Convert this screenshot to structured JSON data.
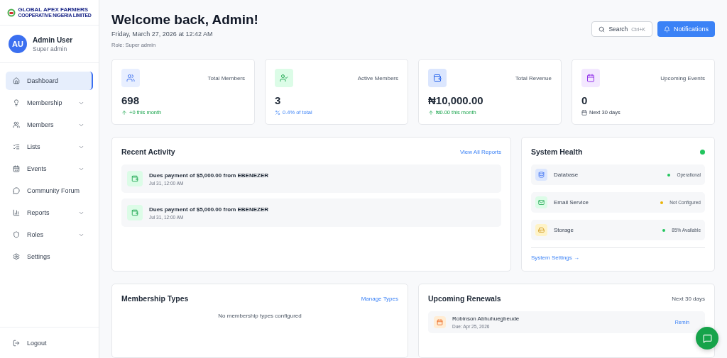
{
  "sidebar": {
    "logo": {
      "line_1": "GLOBAL APEX FARMERS",
      "line_2": "COOPERATIVE NIGERIA LIMITED"
    },
    "user": {
      "initials": "AU",
      "name": "Admin User",
      "role": "Super admin"
    },
    "items": [
      {
        "label": "Dashboard",
        "selected": true,
        "expandable": false
      },
      {
        "label": "Membership",
        "selected": false,
        "expandable": true
      },
      {
        "label": "Members",
        "selected": false,
        "expandable": true
      },
      {
        "label": "Lists",
        "selected": false,
        "expandable": true
      },
      {
        "label": "Events",
        "selected": false,
        "expandable": true
      },
      {
        "label": "Community Forum",
        "selected": false,
        "expandable": false
      },
      {
        "label": "Reports",
        "selected": false,
        "expandable": true
      },
      {
        "label": "Roles",
        "selected": false,
        "expandable": true
      },
      {
        "label": "Settings",
        "selected": false,
        "expandable": false
      }
    ],
    "logout": "Logout"
  },
  "header": {
    "title": "Welcome back, Admin!",
    "date": "Friday, March 27, 2026 at 12:42 AM",
    "role": "Role: Super admin",
    "search": {
      "label": "Search",
      "shortcut": "Ctrl+K"
    },
    "notifications": "Notifications"
  },
  "stats": [
    {
      "label": "Total Members",
      "value": "698",
      "note": "+0 this month",
      "kind": "up"
    },
    {
      "label": "Active Members",
      "value": "3",
      "note": "0.4% of total",
      "kind": "percent"
    },
    {
      "label": "Total Revenue",
      "value": "₦10,000.00",
      "note": "₦0.00 this month",
      "kind": "up"
    },
    {
      "label": "Upcoming Events",
      "value": "0",
      "note": "Next 30 days",
      "kind": "calendar"
    }
  ],
  "recent_activity": {
    "title": "Recent Activity",
    "link": "View All Reports",
    "items": [
      {
        "text": "Dues payment of $5,000.00 from EBENEZER",
        "time": "Jul 31, 12:00 AM"
      },
      {
        "text": "Dues payment of $5,000.00 from EBENEZER",
        "time": "Jul 31, 12:00 AM"
      }
    ]
  },
  "system_health": {
    "title": "System Health",
    "color": "#22c55e",
    "items": [
      {
        "name": "Database",
        "status": "Operational",
        "color": "#22c55e"
      },
      {
        "name": "Email Service",
        "status": "Not Configured",
        "color": "#eab308"
      },
      {
        "name": "Storage",
        "status": "85% Available",
        "color": "#22c55e"
      }
    ],
    "link": "System Settings →"
  },
  "membership_types": {
    "title": "Membership Types",
    "link": "Manage Types",
    "empty": "No membership types configured"
  },
  "upcoming_renewals": {
    "title": "Upcoming Renewals",
    "range": "Next 30 days",
    "items": [
      {
        "name": "Robinson Abhuhuegbeude",
        "due": "Due: Apr 25, 2026",
        "action": "Remin"
      }
    ]
  }
}
